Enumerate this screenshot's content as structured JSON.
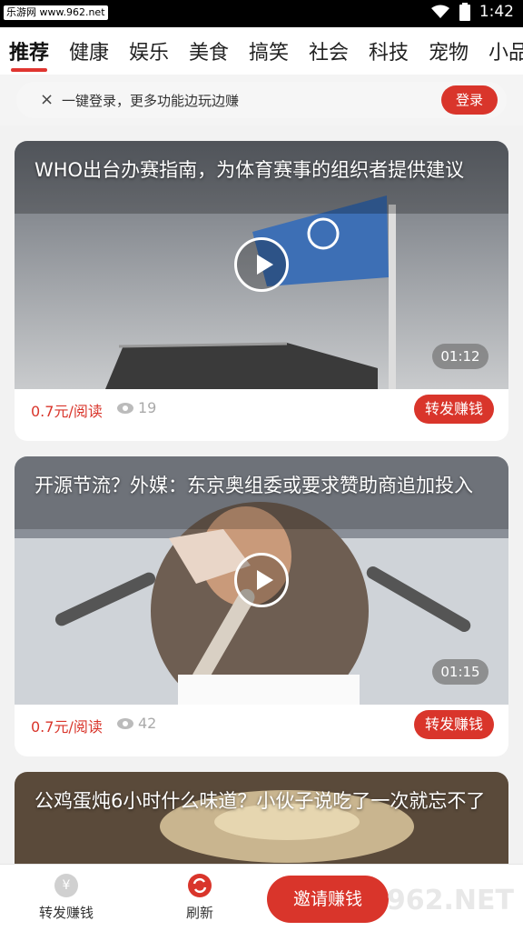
{
  "status_bar": {
    "source": "乐游网 www.962.net",
    "time": "1:42"
  },
  "tabs": [
    "推荐",
    "健康",
    "娱乐",
    "美食",
    "搞笑",
    "社会",
    "科技",
    "宠物",
    "小品"
  ],
  "banner": {
    "text": "一键登录，更多功能边玩边赚",
    "login_label": "登录"
  },
  "cards": [
    {
      "title": "WHO出台办赛指南，为体育赛事的组织者提供建议",
      "duration": "01:12",
      "price": "0.7元/阅读",
      "views": "19",
      "share_label": "转发赚钱"
    },
    {
      "title": "开源节流？外媒：东京奥组委或要求赞助商追加投入",
      "duration": "01:15",
      "price": "0.7元/阅读",
      "views": "42",
      "share_label": "转发赚钱"
    },
    {
      "title": "公鸡蛋炖6小时什么味道？小伙子说吃了一次就忘不了"
    }
  ],
  "bottom_nav": {
    "share_label": "转发赚钱",
    "refresh_label": "刷新",
    "invite_label": "邀请赚钱"
  },
  "watermark": "962.NET"
}
